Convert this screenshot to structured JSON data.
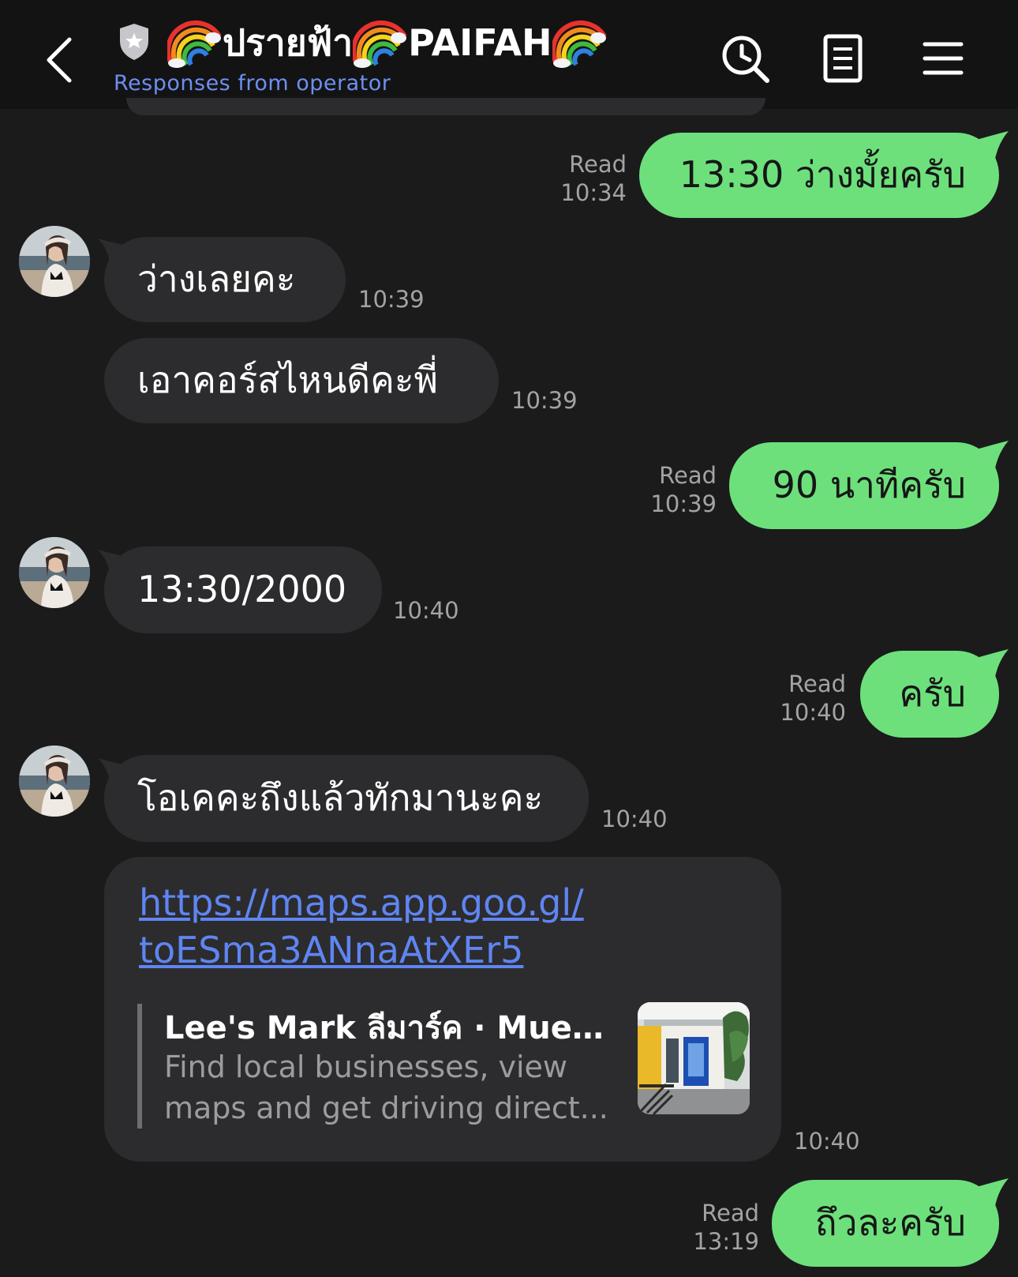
{
  "header": {
    "title_thai": "ปรายฟ้า",
    "title_latin": "PAIFAH",
    "subtitle": "Responses from operator",
    "icons": [
      "back-icon",
      "shield-badge-icon",
      "rainbow-emoji",
      "search-history-icon",
      "notes-icon",
      "menu-icon"
    ]
  },
  "messages": [
    {
      "from": "me",
      "text": "13:30 ว่างมั้ยครับ",
      "read": "Read",
      "time": "10:34"
    },
    {
      "from": "other",
      "text": "ว่างเลยคะ",
      "time": "10:39"
    },
    {
      "from": "other",
      "text": "เอาคอร์สไหนดีคะพี่",
      "time": "10:39"
    },
    {
      "from": "me",
      "text": "90 นาทีครับ",
      "read": "Read",
      "time": "10:39"
    },
    {
      "from": "other",
      "text": "13:30/2000",
      "time": "10:40"
    },
    {
      "from": "me",
      "text": "ครับ",
      "read": "Read",
      "time": "10:40"
    },
    {
      "from": "other",
      "text": "โอเคคะถึงแล้วทักมานะคะ",
      "time": "10:40"
    },
    {
      "from": "other",
      "type": "link",
      "url_line1": "https://maps.app.goo.gl/",
      "url_line2": "toESma3ANnaAtXEr5",
      "preview_title": "Lee's Mark ลีมาร์ค · Mue...",
      "preview_desc_line1": "Find local businesses, view",
      "preview_desc_line2": "maps and get driving direct...",
      "time": "10:40"
    },
    {
      "from": "me",
      "text": "ถึวละครับ",
      "read": "Read",
      "time": "13:19"
    }
  ],
  "colors": {
    "background": "#1b1b1c",
    "header": "#131314",
    "incoming_bubble": "#2c2c2e",
    "outgoing_bubble": "#6de07c",
    "link": "#5f85f2",
    "subtitle": "#6e8ff0"
  }
}
